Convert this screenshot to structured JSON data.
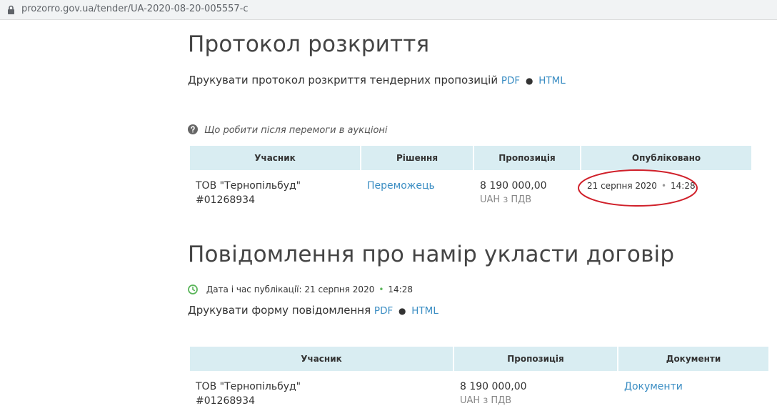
{
  "browser": {
    "url": "prozorro.gov.ua/tender/UA-2020-08-20-005557-c"
  },
  "opening_protocol": {
    "title": "Протокол розкриття",
    "print_text": "Друкувати протокол розкриття тендерних пропозицій",
    "pdf_label": "PDF",
    "bullet": "●",
    "html_label": "HTML",
    "help_text": "Що робити після перемоги в аукціоні",
    "table": {
      "headers": [
        "Учасник",
        "Рішення",
        "Пропозиція",
        "Опубліковано"
      ],
      "rows": [
        {
          "participant_name": "ТОВ \"Тернопільбуд\"",
          "participant_code": "#01268934",
          "decision": "Переможець",
          "amount": "8 190 000,00",
          "amount_note": "UAH з ПДВ",
          "published_date": "21 серпня 2020",
          "published_sep": "•",
          "published_time": "14:28"
        }
      ]
    }
  },
  "intent_notice": {
    "title": "Повідомлення про намір укласти договір",
    "published_label": "Дата і час публікації:",
    "published_date": "21 серпня 2020",
    "published_sep": "•",
    "published_time": "14:28",
    "print_text": "Друкувати форму повідомлення",
    "pdf_label": "PDF",
    "bullet": "●",
    "html_label": "HTML",
    "table": {
      "headers": [
        "Учасник",
        "Пропозиція",
        "Документи"
      ],
      "rows": [
        {
          "participant_name": "ТОВ \"Тернопільбуд\"",
          "participant_code": "#01268934",
          "amount": "8 190 000,00",
          "amount_note": "UAH з ПДВ",
          "documents_link": "Документи"
        }
      ]
    }
  },
  "colors": {
    "link": "#3a8dc3",
    "header_bg": "#d9edf2",
    "highlight_ellipse": "#d0202a",
    "clock_icon": "#5ab55a"
  }
}
